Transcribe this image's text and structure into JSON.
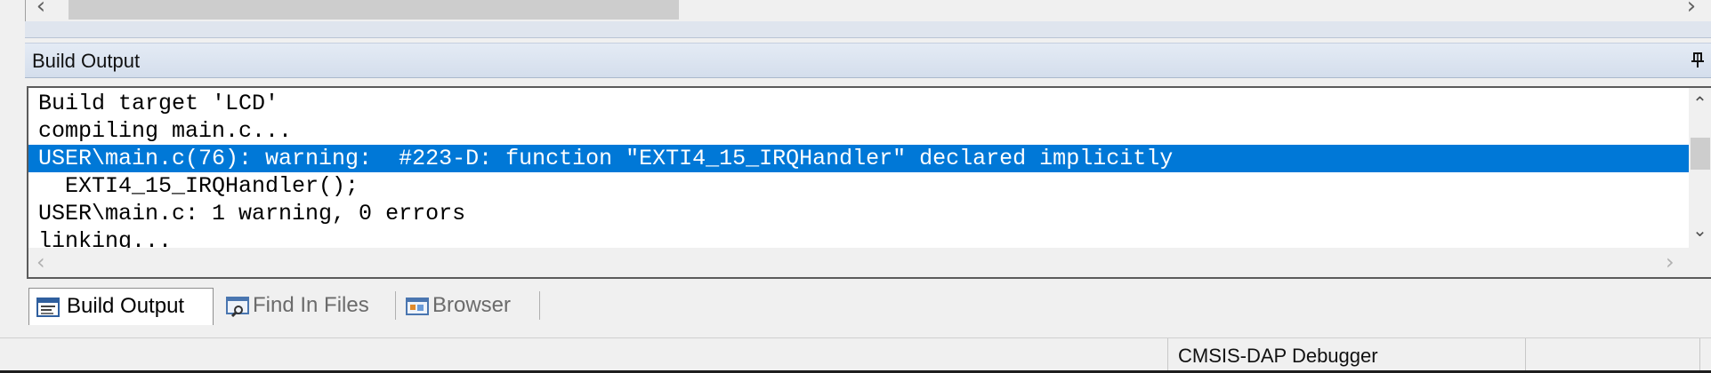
{
  "colors": {
    "selection": "#0078d7",
    "panel_title": "#d4deec",
    "close_button": "#d94b3d"
  },
  "panel": {
    "title": "Build Output",
    "pin_icon": "pin-icon",
    "close_icon": "close-icon"
  },
  "output": {
    "lines": [
      "Build target 'LCD'",
      "compiling main.c...",
      "USER\\main.c(76): warning:  #223-D: function \"EXTI4_15_IRQHandler\" declared implicitly",
      "  EXTI4_15_IRQHandler();",
      "USER\\main.c: 1 warning, 0 errors",
      "linking..."
    ],
    "selected_index": 2
  },
  "tabs": [
    {
      "label": "Build Output",
      "icon": "build-output-icon",
      "active": true
    },
    {
      "label": "Find In Files",
      "icon": "find-in-files-icon",
      "active": false
    },
    {
      "label": "Browser",
      "icon": "browser-icon",
      "active": false
    }
  ],
  "status": {
    "debugger": "CMSIS-DAP Debugger"
  }
}
